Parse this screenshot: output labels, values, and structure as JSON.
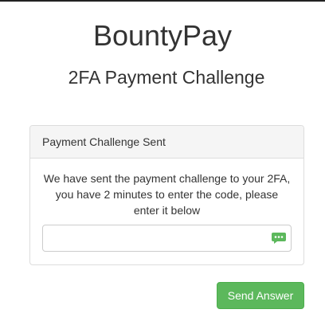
{
  "header": {
    "app_title": "BountyPay",
    "subtitle": "2FA Payment Challenge"
  },
  "panel": {
    "heading": "Payment Challenge Sent",
    "message": "We have sent the payment challenge to your 2FA, you have 2 minutes to enter the code, please enter it below",
    "code_input": {
      "value": "",
      "placeholder": "",
      "icon": "sms-icon"
    }
  },
  "actions": {
    "send_label": "Send Answer"
  },
  "colors": {
    "primary_button": "#5cb85c",
    "panel_heading_bg": "#f5f5f5",
    "text": "#333333",
    "sms_icon": "#5cb85c"
  }
}
